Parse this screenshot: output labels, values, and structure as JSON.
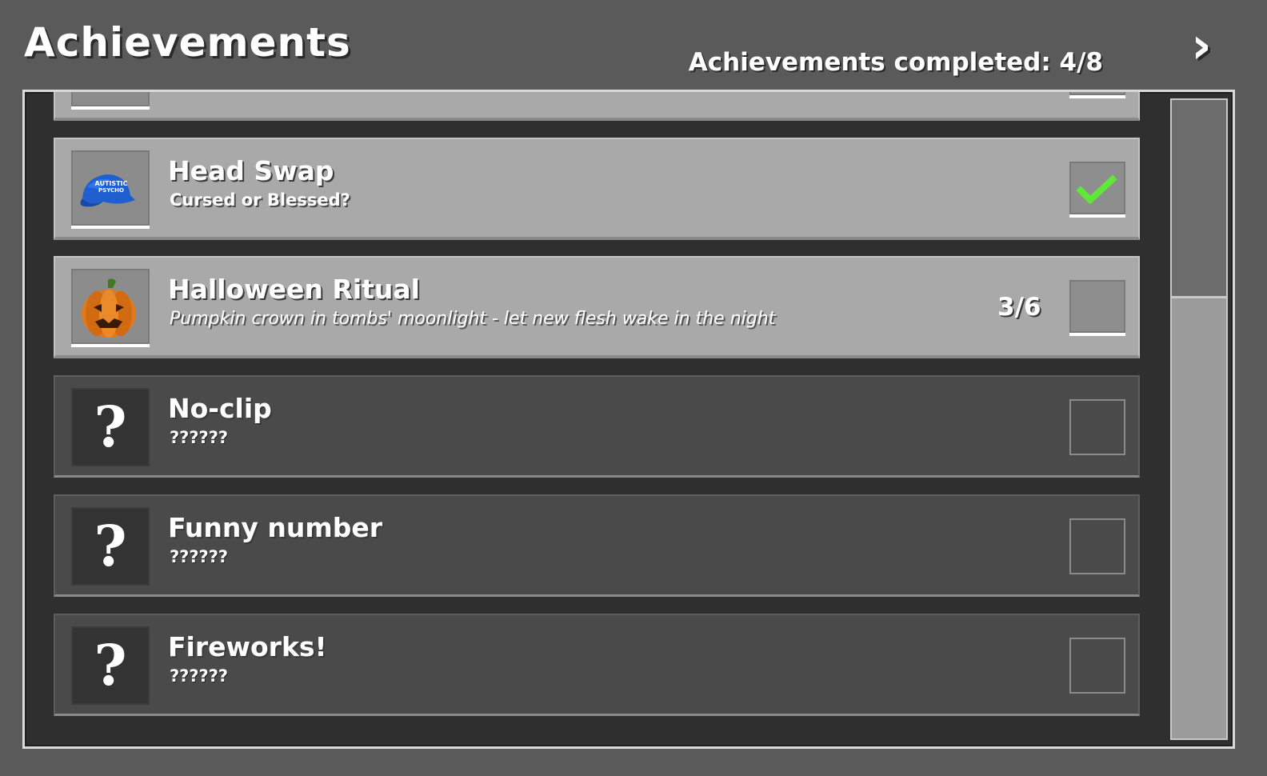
{
  "header": {
    "title": "Achievements",
    "completed_text": "Achievements completed: 4/8",
    "next_icon": "chevron-right-icon"
  },
  "achievements": [
    {
      "name": "",
      "description": "",
      "state": "unlocked",
      "completed": false,
      "partially_visible": true
    },
    {
      "name": "Head Swap",
      "description": "Cursed or Blessed?",
      "state": "unlocked",
      "icon": "blue-cap-icon",
      "completed": true
    },
    {
      "name": "Halloween Ritual",
      "description": "Pumpkin crown in tombs' moonlight - let new flesh wake in the night",
      "state": "unlocked",
      "icon": "pumpkin-icon",
      "progress": "3/6",
      "completed": false
    },
    {
      "name": "No-clip",
      "description": "??????",
      "state": "locked",
      "icon": "question-mark-icon",
      "completed": false
    },
    {
      "name": "Funny number",
      "description": "??????",
      "state": "locked",
      "icon": "question-mark-icon",
      "completed": false
    },
    {
      "name": "Fireworks!",
      "description": "??????",
      "state": "locked",
      "icon": "question-mark-icon",
      "completed": false
    }
  ],
  "colors": {
    "background": "#5a5a5a",
    "panel": "#2f2f2f",
    "unlocked_row": "#a9a9a9",
    "locked_row": "#4a4a4a",
    "check_mark": "#5fe83a"
  }
}
